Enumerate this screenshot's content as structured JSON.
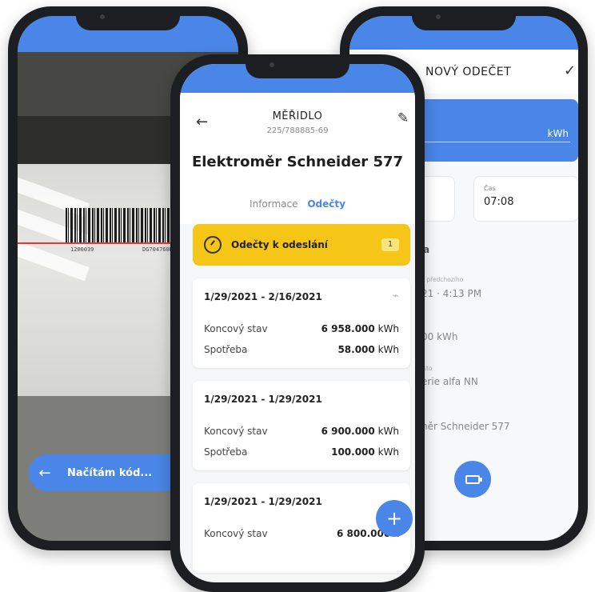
{
  "colors": {
    "accent": "#4a86e8",
    "warning": "#f5c518",
    "phone_frame": "#1d1e22"
  },
  "scanner": {
    "barcode_left": "1200039",
    "barcode_right": "DG704760RY",
    "status_label": "Načítám kód...",
    "back_icon": "arrow-left-icon"
  },
  "new_reading": {
    "title": "NOVÝ ODEČET",
    "confirm_icon": "check-icon",
    "unit": "kWh",
    "time_label": "Čas",
    "time_value": "07:08",
    "previous_label": "s předchozího",
    "previous_value": "21 · 4:13 PM",
    "value_fragment": "00 kWh",
    "place_label": "isto",
    "place_value": "erie alfa NN",
    "meter_fragment": "něr Schneider 577",
    "fab_icon": "battery-icon"
  },
  "meter": {
    "title": "MĚŘIDLO",
    "serial": "225/788885-69",
    "name": "Elektroměr Schneider 577",
    "tabs": [
      {
        "label": "Informace",
        "active": false
      },
      {
        "label": "Odečty",
        "active": true
      }
    ],
    "to_send": {
      "label": "Odečty k odeslání",
      "count": "1"
    },
    "readings": [
      {
        "range": "1/29/2021 - 2/16/2021",
        "final_label": "Koncový stav",
        "final_value": "6 958.000",
        "final_unit": "kWh",
        "usage_label": "Spotřeba",
        "usage_value": "58.000",
        "usage_unit": "kWh",
        "offline": true
      },
      {
        "range": "1/29/2021 - 1/29/2021",
        "final_label": "Koncový stav",
        "final_value": "6 900.000",
        "final_unit": "kWh",
        "usage_label": "Spotřeba",
        "usage_value": "100.000",
        "usage_unit": "kWh",
        "offline": false
      },
      {
        "range": "1/29/2021 - 1/29/2021",
        "final_label": "Koncový stav",
        "final_value": "6 800.000",
        "final_unit": "k",
        "offline": false
      }
    ],
    "fab_label": "+"
  }
}
